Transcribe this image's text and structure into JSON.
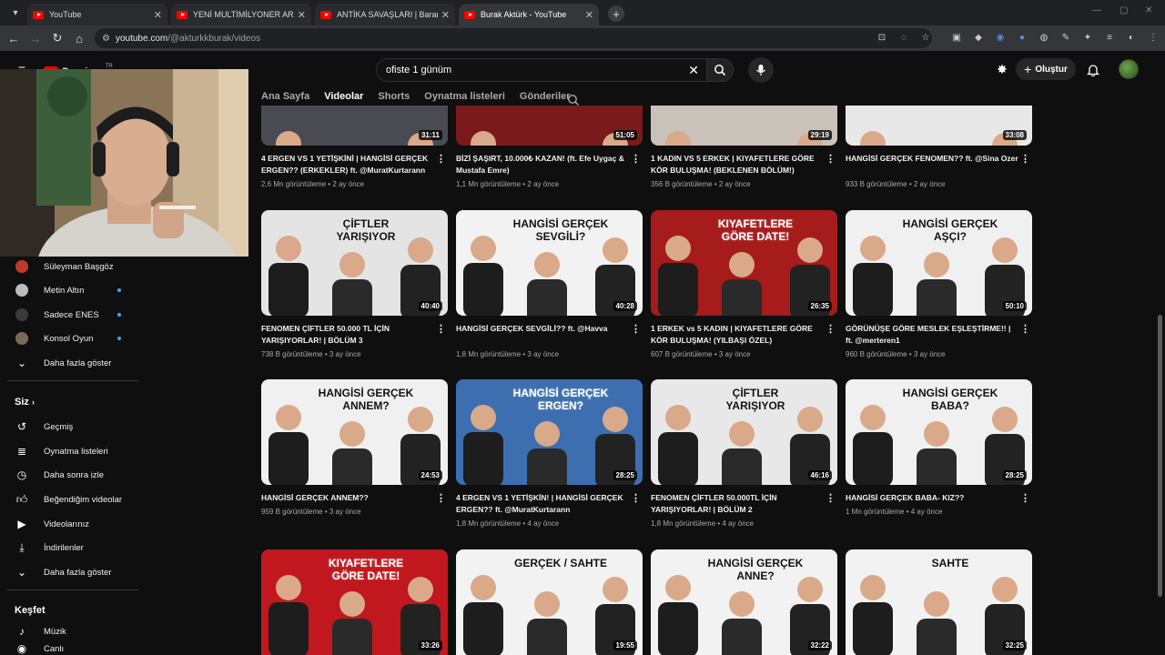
{
  "browser": {
    "tabs": [
      {
        "label": "YouTube",
        "active": false
      },
      {
        "label": "YENİ MULTİMİLYONER ARABAN",
        "active": false
      },
      {
        "label": "ANTİKA SAVAŞLARI | Baran Gü",
        "active": false
      },
      {
        "label": "Burak Aktürk - YouTube",
        "active": true
      }
    ],
    "url_host": "youtube.com",
    "url_path": "/@akturkkburak/videos"
  },
  "youtube": {
    "logo_text": "Premium",
    "logo_region": "TR",
    "search_value": "ofiste 1 günüm",
    "create_label": "Oluştur",
    "channel_tabs": [
      "Ana Sayfa",
      "Videolar",
      "Shorts",
      "Oynatma listeleri",
      "Gönderiler"
    ],
    "active_tab": "Videolar"
  },
  "sidebar": {
    "subscriptions": [
      {
        "name": "Süleyman Başgöz",
        "dot": false,
        "color": "#c0392b"
      },
      {
        "name": "Metin Altın",
        "dot": true,
        "color": "#bcbcbc"
      },
      {
        "name": "Sadece ENES",
        "dot": true,
        "color": "#3b3b3b"
      },
      {
        "name": "Konsol Oyun",
        "dot": true,
        "color": "#7a6a5a"
      }
    ],
    "show_more_1": "Daha fazla göster",
    "you_heading": "Siz",
    "you_items": [
      {
        "label": "Geçmiş",
        "icon": "history-icon"
      },
      {
        "label": "Oynatma listeleri",
        "icon": "playlist-icon"
      },
      {
        "label": "Daha sonra izle",
        "icon": "clock-icon"
      },
      {
        "label": "Beğendiğim videolar",
        "icon": "thumbs-up-icon"
      },
      {
        "label": "Videolarınız",
        "icon": "video-icon"
      },
      {
        "label": "İndirilenler",
        "icon": "download-icon"
      }
    ],
    "show_more_2": "Daha fazla göster",
    "explore_heading": "Keşfet",
    "explore_items": [
      {
        "label": "Müzik",
        "icon": "music-icon"
      },
      {
        "label": "Canlı",
        "icon": "live-icon"
      }
    ]
  },
  "videos": [
    {
      "title": "4 ERGEN VS 1 YETİŞKİNİ | HANGİSİ GERÇEK ERGEN?? (ERKEKLER) ft. @MuratKurtarann",
      "meta": "2,6 Mn görüntüleme • 2 ay önce",
      "duration": "31:11",
      "thumb_text": "",
      "bg": "#4a4a52"
    },
    {
      "title": "BİZİ ŞAŞIRT, 10.000₺ KAZAN! (ft. Efe Uygaç & Mustafa Emre)",
      "meta": "1,1 Mn görüntüleme • 2 ay önce",
      "duration": "51:05",
      "thumb_text": "",
      "bg": "#7a1a1a"
    },
    {
      "title": "1 KADIN VS 5 ERKEK | KIYAFETLERE GÖRE KÖR BULUŞMA! (BEKLENEN BÖLÜM!)",
      "meta": "356 B görüntüleme • 2 ay önce",
      "duration": "29:19",
      "thumb_text": "",
      "bg": "#c9c2b8"
    },
    {
      "title": "HANGİSİ GERÇEK FENOMEN?? ft. @Sina Ozer",
      "meta": "933 B görüntüleme • 2 ay önce",
      "duration": "33:08",
      "thumb_text": "",
      "bg": "#e8e8e8"
    },
    {
      "title": "FENOMEN ÇİFTLER 50.000 TL İÇİN YARIŞIYORLAR! | BÖLÜM 3",
      "meta": "738 B görüntüleme • 3 ay önce",
      "duration": "40:40",
      "thumb_text": "ÇİFTLER YARIŞIYOR",
      "bg": "#e4e4e4"
    },
    {
      "title": "HANGİSİ GERÇEK SEVGİLİ?? ft. @Havva",
      "meta": "1,8 Mn görüntüleme • 3 ay önce",
      "duration": "40:28",
      "thumb_text": "HANGİSİ GERÇEK SEVGİLİ?",
      "bg": "#f2f2f2"
    },
    {
      "title": "1 ERKEK vs 5 KADIN | KIYAFETLERE GÖRE KÖR BULUŞMA! (YILBAŞI ÖZEL)",
      "meta": "607 B görüntüleme • 3 ay önce",
      "duration": "26:35",
      "thumb_text": "KIYAFETLERE GÖRE DATE!",
      "bg": "#a61b1b"
    },
    {
      "title": "GÖRÜNÜŞE GÖRE MESLEK EŞLEŞTİRME!! | ft. @merteren1",
      "meta": "960 B görüntüleme • 3 ay önce",
      "duration": "50:10",
      "thumb_text": "HANGİSİ GERÇEK AŞÇI?",
      "bg": "#f0f0f0"
    },
    {
      "title": "HANGİSİ GERÇEK ANNEM??",
      "meta": "959 B görüntüleme • 3 ay önce",
      "duration": "24:53",
      "thumb_text": "HANGİSİ GERÇEK ANNEM?",
      "bg": "#f0f0f0"
    },
    {
      "title": "4 ERGEN VS 1 YETİŞKİN! | HANGİSİ GERÇEK ERGEN?? ft. @MuratKurtarann",
      "meta": "1,8 Mn görüntüleme • 4 ay önce",
      "duration": "28:25",
      "thumb_text": "HANGİSİ GERÇEK ERGEN?",
      "bg": "#3d6fb0"
    },
    {
      "title": "FENOMEN ÇİFTLER 50.000TL İÇİN YARIŞIYORLAR! | BÖLÜM 2",
      "meta": "1,8 Mn görüntüleme • 4 ay önce",
      "duration": "46:16",
      "thumb_text": "ÇİFTLER YARIŞIYOR",
      "bg": "#e8e8e8"
    },
    {
      "title": "HANGİSİ GERÇEK BABA- KIZ??",
      "meta": "1 Mn görüntüleme • 4 ay önce",
      "duration": "28:25",
      "thumb_text": "HANGİSİ GERÇEK BABA?",
      "bg": "#f0f0f0"
    },
    {
      "title": "",
      "meta": "",
      "duration": "33:26",
      "thumb_text": "KIYAFETLERE GÖRE DATE!",
      "bg": "#c0181e"
    },
    {
      "title": "",
      "meta": "",
      "duration": "19:55",
      "thumb_text": "GERÇEK / SAHTE",
      "bg": "#f2f2f2"
    },
    {
      "title": "",
      "meta": "",
      "duration": "32:22",
      "thumb_text": "HANGİSİ GERÇEK ANNE?",
      "bg": "#f2f2f2"
    },
    {
      "title": "",
      "meta": "",
      "duration": "32:25",
      "thumb_text": "SAHTE",
      "bg": "#f2f2f2"
    }
  ]
}
